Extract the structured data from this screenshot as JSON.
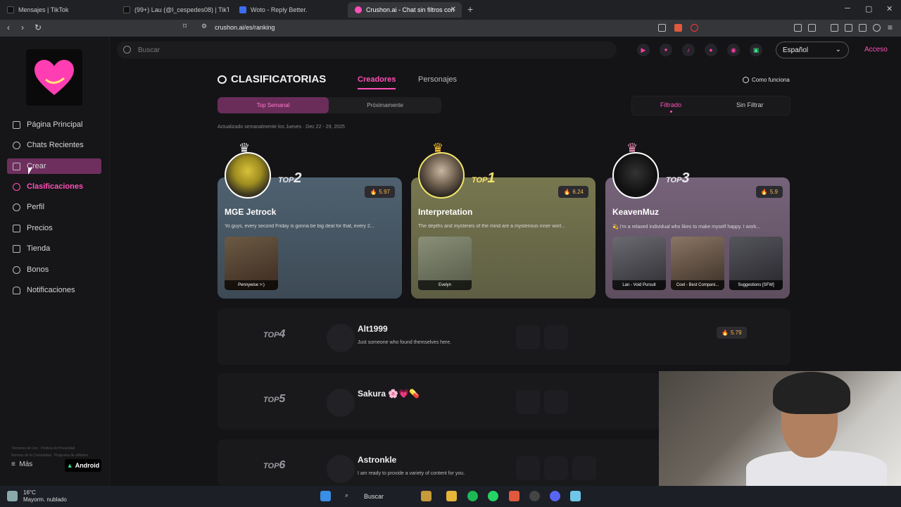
{
  "browser": {
    "tabs": [
      {
        "label": "Mensajes | TikTok",
        "active": false
      },
      {
        "label": "(99+) Lau (@l_cespedes08) | TikTok",
        "active": false
      },
      {
        "label": "Woto - Reply Better.",
        "active": false
      },
      {
        "label": "Crushon.ai - Chat sin filtros con",
        "active": true
      }
    ],
    "url": "crushon.ai/es/ranking"
  },
  "header": {
    "search_placeholder": "Buscar",
    "language": "Español",
    "login": "Acceso"
  },
  "sidebar": {
    "items": [
      {
        "label": "Página Principal",
        "icon": "home-icon"
      },
      {
        "label": "Chats Recientes",
        "icon": "chat-icon"
      },
      {
        "label": "Crear",
        "icon": "create-icon"
      },
      {
        "label": "Clasificaciones",
        "icon": "ranking-icon"
      },
      {
        "label": "Perfil",
        "icon": "profile-icon"
      },
      {
        "label": "Precios",
        "icon": "pricing-icon"
      },
      {
        "label": "Tienda",
        "icon": "store-icon"
      },
      {
        "label": "Bonos",
        "icon": "bonus-icon"
      },
      {
        "label": "Notificaciones",
        "icon": "bell-icon"
      }
    ],
    "footer": [
      "Términos de Uso",
      "Política de Privacidad",
      "Normas de la Comunidad",
      "Programa de afiliados"
    ],
    "more": "Más",
    "android": "Android"
  },
  "ranking": {
    "title": "CLASIFICATORIAS",
    "tabs": [
      "Creadores",
      "Personajes"
    ],
    "how_it_works": "Como funciona",
    "period_tabs": [
      "Top Semanal",
      "Próximamente"
    ],
    "filter_tabs": [
      "Filtrado",
      "Sin Filtrar"
    ],
    "updated": "Actualizado semanalmente los Jueves · Dec 22 - 29, 2025",
    "top_label": "TOP",
    "podium": [
      {
        "rank": "2",
        "name": "MGE Jetrock",
        "score": "5.97",
        "desc": "Yo guys, every second Friday is gonna be big deal for that, every 2...",
        "thumbs": [
          "Pennywise >:)"
        ],
        "color": "#4b5a66"
      },
      {
        "rank": "1",
        "name": "Interpretation",
        "score": "6.24",
        "desc": "The depths and mysteries of the mind are a mysterious inner worl...",
        "thumbs": [
          "Evelyn"
        ],
        "color": "#6b6b4f"
      },
      {
        "rank": "3",
        "name": "KeavenMuz",
        "score": "5.9",
        "desc": "💫 I'm a relaxed individual who likes to make myself happy. I work...",
        "thumbs": [
          "Lan - Void Pursuit",
          "Coel - Best Compani...",
          "Suggestions [SFW]"
        ],
        "color": "#6c5a6b"
      }
    ],
    "list": [
      {
        "rank": "4",
        "name": "Alt1999",
        "desc": "Just someone who found themselves here.",
        "score": "5.79"
      },
      {
        "rank": "5",
        "name": "Sakura 🌸💗💊",
        "desc": "",
        "score": ""
      },
      {
        "rank": "6",
        "name": "Astronkle",
        "desc": "I am ready to provide a variety of content for you.",
        "score": ""
      }
    ]
  },
  "taskbar": {
    "temp": "16°C",
    "weather": "Mayorm. nublado",
    "search": "Buscar"
  }
}
